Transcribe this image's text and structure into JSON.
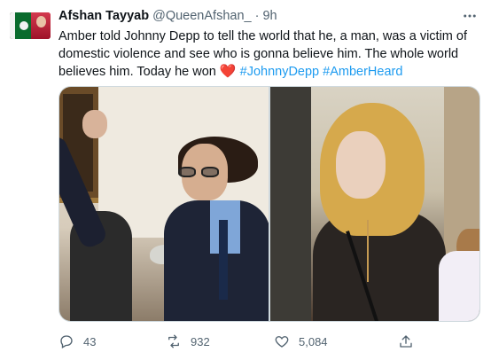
{
  "author": {
    "name": "Afshan Tayyab",
    "handle": "@QueenAfshan_",
    "separator": "·",
    "time": "9h"
  },
  "tweet": {
    "text_main": "Amber told Johnny Depp to tell the world that he, a man, was a victim of domestic violence and see who is gonna believe him. The whole world believes him. Today he won",
    "heart": "❤️",
    "hashtags": [
      "#JohnnyDepp",
      "#AmberHeard"
    ]
  },
  "media": {
    "photos": [
      "photo-johnny-depp",
      "photo-amber-heard"
    ]
  },
  "actions": {
    "replies": "43",
    "retweets": "932",
    "likes": "5,084"
  },
  "icons": {
    "more": "more-icon",
    "reply": "reply-icon",
    "retweet": "retweet-icon",
    "like": "heart-icon",
    "share": "share-icon"
  },
  "colors": {
    "link": "#1d9bf0",
    "muted": "#536471",
    "heart": "#e0245e",
    "text": "#0f1419"
  }
}
